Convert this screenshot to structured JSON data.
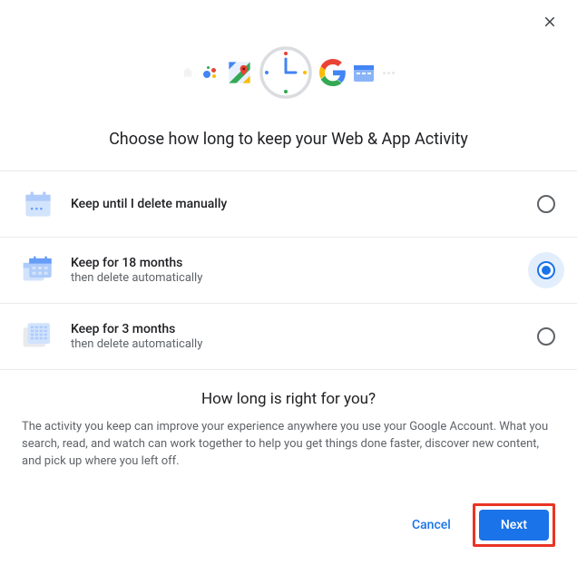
{
  "header": {
    "title": "Choose how long to keep your Web & App Activity"
  },
  "options": [
    {
      "title": "Keep until I delete manually",
      "sub": "",
      "selected": false,
      "icon": "calendar-dots"
    },
    {
      "title": "Keep for 18 months",
      "sub": "then delete automatically",
      "selected": true,
      "icon": "calendar-stack"
    },
    {
      "title": "Keep for 3 months",
      "sub": "then delete automatically",
      "selected": false,
      "icon": "calendar-grid"
    }
  ],
  "footer": {
    "title": "How long is right for you?",
    "body": "The activity you keep can improve your experience anywhere you use your Google Account. What you search, read, and watch can work together to help you get things done faster, discover new content, and pick up where you left off."
  },
  "actions": {
    "cancel": "Cancel",
    "next": "Next"
  }
}
